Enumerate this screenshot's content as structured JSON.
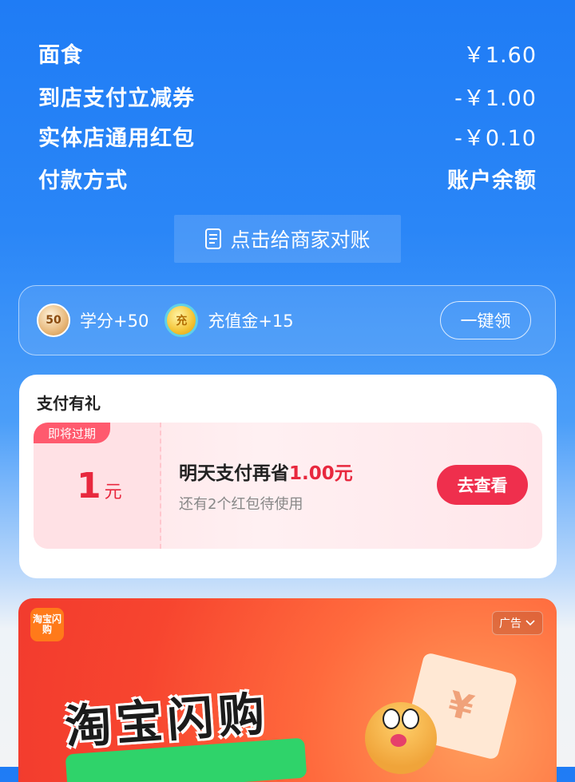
{
  "summary": {
    "rows": [
      {
        "label": "面食",
        "value": "￥1.60"
      },
      {
        "label": "到店支付立减券",
        "value": "-￥1.00"
      },
      {
        "label": "实体店通用红包",
        "value": "-￥0.10"
      },
      {
        "label": "付款方式",
        "value": "账户余额"
      }
    ]
  },
  "reconcile": {
    "label": "点击给商家对账",
    "icon": "document-icon"
  },
  "rewards": {
    "credit_coin_text": "50",
    "credit_label": "学分+50",
    "gold_coin_text": "充",
    "recharge_label": "充值金+15",
    "claim_label": "一键领"
  },
  "gift": {
    "title": "支付有礼",
    "expire_tag": "即将过期",
    "amount": "1",
    "unit": "元",
    "line1_prefix": "明天支付再省",
    "line1_highlight": "1.00元",
    "line2": "还有2个红包待使用",
    "view_label": "去查看",
    "accent_color": "#e8283e"
  },
  "ad": {
    "logo_text": "淘宝闪购",
    "badge_label": "广告",
    "headline": "淘宝闪购",
    "ticket_symbol": "¥"
  }
}
